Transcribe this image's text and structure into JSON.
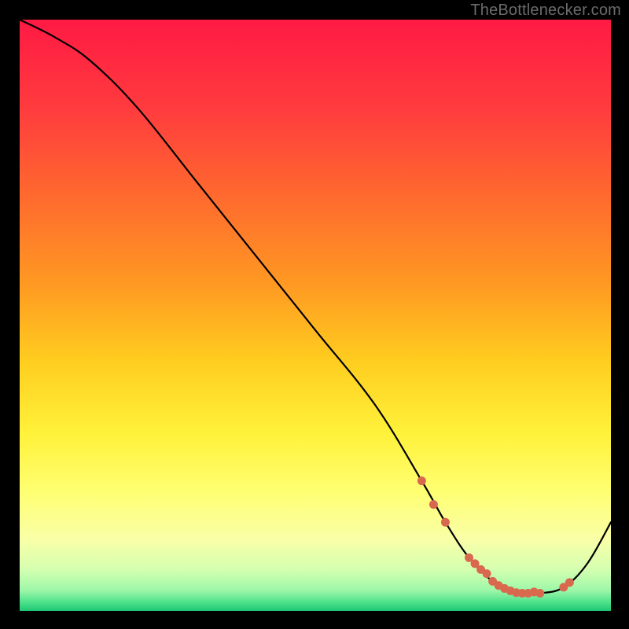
{
  "watermark": "TheBottlenecker.com",
  "colors": {
    "bg": "#000000",
    "gradient_stops": [
      {
        "offset": 0.0,
        "color": "#ff1a44"
      },
      {
        "offset": 0.15,
        "color": "#ff3b3e"
      },
      {
        "offset": 0.3,
        "color": "#ff6a2e"
      },
      {
        "offset": 0.45,
        "color": "#ff9a22"
      },
      {
        "offset": 0.58,
        "color": "#ffce1f"
      },
      {
        "offset": 0.7,
        "color": "#fff23a"
      },
      {
        "offset": 0.8,
        "color": "#ffff73"
      },
      {
        "offset": 0.88,
        "color": "#f9ffa8"
      },
      {
        "offset": 0.93,
        "color": "#d4ffb0"
      },
      {
        "offset": 0.965,
        "color": "#9ef7a9"
      },
      {
        "offset": 0.985,
        "color": "#4fe28c"
      },
      {
        "offset": 1.0,
        "color": "#1ec575"
      }
    ],
    "curve": "#000000",
    "marker": "#d9694e",
    "watermark": "#6b6b6b"
  },
  "chart_data": {
    "type": "line",
    "title": "",
    "xlabel": "",
    "ylabel": "",
    "xlim": [
      0,
      100
    ],
    "ylim": [
      0,
      100
    ],
    "series": [
      {
        "name": "bottleneck-curve",
        "x": [
          0,
          6,
          12,
          20,
          30,
          40,
          50,
          60,
          68,
          72,
          76,
          80,
          84,
          88,
          92,
          96,
          100
        ],
        "y": [
          100,
          97,
          93,
          85,
          72.5,
          60,
          47.5,
          35,
          22,
          15,
          9,
          5,
          3,
          3,
          4,
          8,
          15
        ]
      }
    ],
    "markers": {
      "name": "highlighted-points",
      "x": [
        68,
        70,
        72,
        76,
        77,
        78,
        79,
        80,
        81,
        82,
        83,
        84,
        85,
        86,
        87,
        88,
        92,
        93
      ],
      "y": [
        22,
        18,
        15,
        9,
        8,
        7,
        6.3,
        5,
        4.3,
        3.8,
        3.4,
        3.1,
        3.0,
        3.0,
        3.2,
        3,
        4,
        4.8
      ]
    }
  }
}
